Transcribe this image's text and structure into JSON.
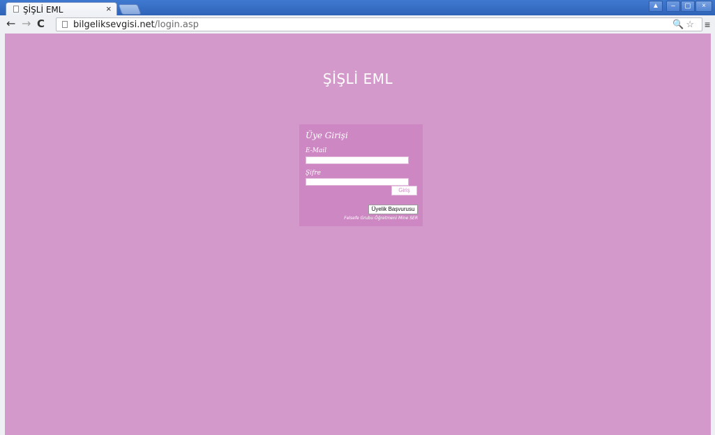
{
  "browser": {
    "tab_title": "ŞİŞLİ EML",
    "tab_close": "×",
    "url_domain": "bilgeliksevgisi.net",
    "url_path": "/login.asp",
    "nav": {
      "back": "←",
      "forward": "→",
      "reload": "C"
    },
    "omnibox_icons": "🔍☆",
    "menu_icon": "≡",
    "window_controls": {
      "user": "▲",
      "minimize": "–",
      "maximize": "▢",
      "close": "×"
    }
  },
  "page": {
    "site_title": "ŞİŞLİ EML",
    "login": {
      "heading": "Üye Girişi",
      "email_label": "E-Mail",
      "email_value": "",
      "password_label": "Şifre",
      "password_value": "",
      "login_button": "Giriş",
      "register_button": "Üyelik Başvurusu",
      "credit": "Felsefe Grubu Öğretmeni Mine SER"
    }
  },
  "colors": {
    "page_background": "#d399ca",
    "login_box": "#cd88c3"
  }
}
